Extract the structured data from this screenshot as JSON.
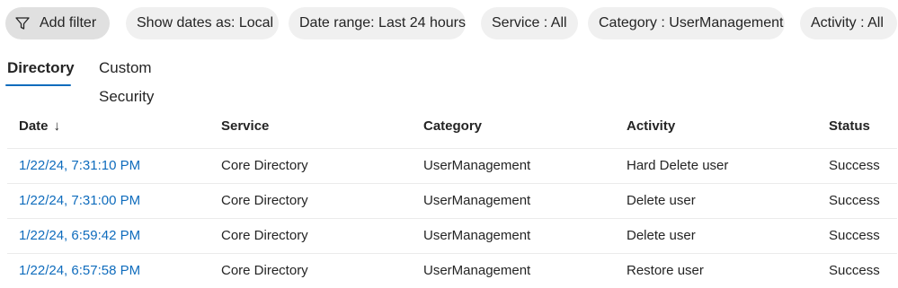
{
  "filters": {
    "add_filter": {
      "label": "Add filter",
      "icon": "funnel-icon"
    },
    "pills": [
      {
        "label": "Show dates as: Local"
      },
      {
        "label": "Date range: Last 24 hours"
      },
      {
        "label": "Service : All"
      },
      {
        "label": "Category : UserManagement"
      },
      {
        "label": "Activity : All"
      }
    ]
  },
  "tabs": [
    {
      "label": "Directory",
      "active": true
    },
    {
      "label": "Custom Security",
      "active": false
    }
  ],
  "table": {
    "columns": [
      "Date",
      "Service",
      "Category",
      "Activity",
      "Status"
    ],
    "sort_icon": "↓",
    "rows": [
      {
        "date": "1/22/24, 7:31:10 PM",
        "service": "Core Directory",
        "category": "UserManagement",
        "activity": "Hard Delete user",
        "status": "Success"
      },
      {
        "date": "1/22/24, 7:31:00 PM",
        "service": "Core Directory",
        "category": "UserManagement",
        "activity": "Delete user",
        "status": "Success"
      },
      {
        "date": "1/22/24, 6:59:42 PM",
        "service": "Core Directory",
        "category": "UserManagement",
        "activity": "Delete user",
        "status": "Success"
      },
      {
        "date": "1/22/24, 6:57:58 PM",
        "service": "Core Directory",
        "category": "UserManagement",
        "activity": "Restore user",
        "status": "Success"
      }
    ]
  },
  "colors": {
    "accent": "#0f6cbd",
    "pill_bg": "#f0f0f0",
    "primary_pill_bg": "#e0e0e0"
  }
}
